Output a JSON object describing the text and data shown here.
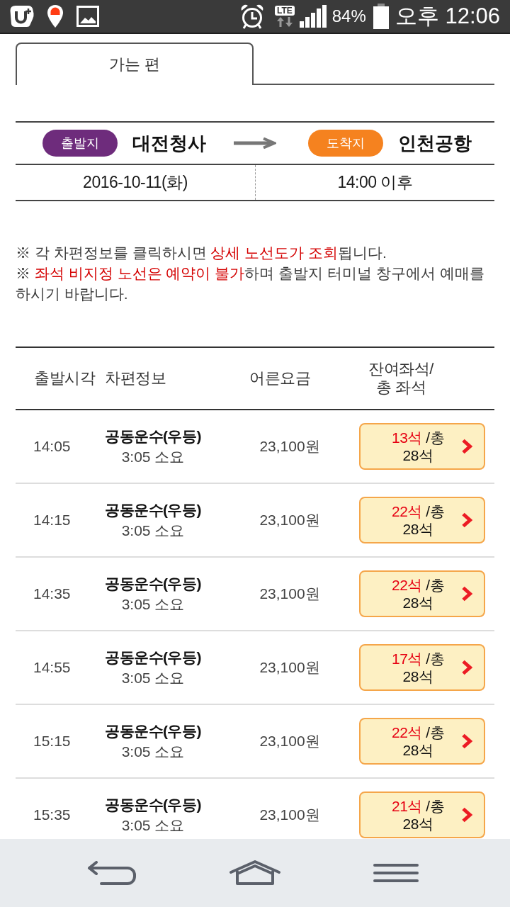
{
  "status_bar": {
    "network": "LTE",
    "battery": "84%",
    "time": "오후 12:06"
  },
  "tabs": [
    {
      "label": "가는 편",
      "selected": true
    }
  ],
  "route": {
    "stops": [
      {
        "badge": "출발지",
        "place": "대전청사",
        "color": "#6e2c7c"
      },
      {
        "badge": "도착지",
        "place": "인천공항",
        "color": "#f5821f"
      }
    ],
    "date": "2016-10-11(화)",
    "time": "14:00 이후"
  },
  "notices": [
    {
      "segments": [
        {
          "text": "※ 각 차편정보를 클릭하시면 ",
          "highlight": false
        },
        {
          "text": "상세 노선도가 조회",
          "highlight": true
        },
        {
          "text": "됩니다.",
          "highlight": false
        }
      ]
    },
    {
      "segments": [
        {
          "text": "※ ",
          "highlight": false
        },
        {
          "text": "좌석 비지정 노선은 예약이 불가",
          "highlight": true
        },
        {
          "text": "하며 출발지 터미널 창구에서 예매를 하시기 바랍니다.",
          "highlight": false
        }
      ]
    }
  ],
  "table": {
    "columns": [
      "출발시각",
      "차편정보",
      "어른요금",
      "잔여좌석/\n총 좌석"
    ],
    "rows": [
      {
        "departure": "14:05",
        "operator": "공동운수(우등)",
        "duration": "3:05 소요",
        "fare": "23,100원",
        "seats_left": "13석",
        "seats_total": "/총 28석"
      },
      {
        "departure": "14:15",
        "operator": "공동운수(우등)",
        "duration": "3:05 소요",
        "fare": "23,100원",
        "seats_left": "22석",
        "seats_total": "/총 28석"
      },
      {
        "departure": "14:35",
        "operator": "공동운수(우등)",
        "duration": "3:05 소요",
        "fare": "23,100원",
        "seats_left": "22석",
        "seats_total": "/총 28석"
      },
      {
        "departure": "14:55",
        "operator": "공동운수(우등)",
        "duration": "3:05 소요",
        "fare": "23,100원",
        "seats_left": "17석",
        "seats_total": "/총 28석"
      },
      {
        "departure": "15:15",
        "operator": "공동운수(우등)",
        "duration": "3:05 소요",
        "fare": "23,100원",
        "seats_left": "22석",
        "seats_total": "/총 28석"
      },
      {
        "departure": "15:35",
        "operator": "공동운수(우등)",
        "duration": "3:05 소요",
        "fare": "23,100원",
        "seats_left": "21석",
        "seats_total": "/총 28석"
      }
    ]
  }
}
